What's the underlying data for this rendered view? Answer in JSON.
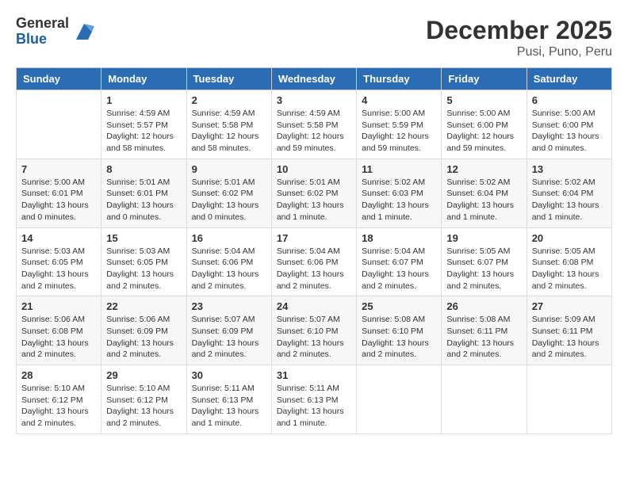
{
  "logo": {
    "general": "General",
    "blue": "Blue"
  },
  "title": "December 2025",
  "subtitle": "Pusi, Puno, Peru",
  "days_of_week": [
    "Sunday",
    "Monday",
    "Tuesday",
    "Wednesday",
    "Thursday",
    "Friday",
    "Saturday"
  ],
  "weeks": [
    [
      {
        "day": "",
        "info": ""
      },
      {
        "day": "1",
        "info": "Sunrise: 4:59 AM\nSunset: 5:57 PM\nDaylight: 12 hours\nand 58 minutes."
      },
      {
        "day": "2",
        "info": "Sunrise: 4:59 AM\nSunset: 5:58 PM\nDaylight: 12 hours\nand 58 minutes."
      },
      {
        "day": "3",
        "info": "Sunrise: 4:59 AM\nSunset: 5:58 PM\nDaylight: 12 hours\nand 59 minutes."
      },
      {
        "day": "4",
        "info": "Sunrise: 5:00 AM\nSunset: 5:59 PM\nDaylight: 12 hours\nand 59 minutes."
      },
      {
        "day": "5",
        "info": "Sunrise: 5:00 AM\nSunset: 6:00 PM\nDaylight: 12 hours\nand 59 minutes."
      },
      {
        "day": "6",
        "info": "Sunrise: 5:00 AM\nSunset: 6:00 PM\nDaylight: 13 hours\nand 0 minutes."
      }
    ],
    [
      {
        "day": "7",
        "info": "Sunrise: 5:00 AM\nSunset: 6:01 PM\nDaylight: 13 hours\nand 0 minutes."
      },
      {
        "day": "8",
        "info": "Sunrise: 5:01 AM\nSunset: 6:01 PM\nDaylight: 13 hours\nand 0 minutes."
      },
      {
        "day": "9",
        "info": "Sunrise: 5:01 AM\nSunset: 6:02 PM\nDaylight: 13 hours\nand 0 minutes."
      },
      {
        "day": "10",
        "info": "Sunrise: 5:01 AM\nSunset: 6:02 PM\nDaylight: 13 hours\nand 1 minute."
      },
      {
        "day": "11",
        "info": "Sunrise: 5:02 AM\nSunset: 6:03 PM\nDaylight: 13 hours\nand 1 minute."
      },
      {
        "day": "12",
        "info": "Sunrise: 5:02 AM\nSunset: 6:04 PM\nDaylight: 13 hours\nand 1 minute."
      },
      {
        "day": "13",
        "info": "Sunrise: 5:02 AM\nSunset: 6:04 PM\nDaylight: 13 hours\nand 1 minute."
      }
    ],
    [
      {
        "day": "14",
        "info": "Sunrise: 5:03 AM\nSunset: 6:05 PM\nDaylight: 13 hours\nand 2 minutes."
      },
      {
        "day": "15",
        "info": "Sunrise: 5:03 AM\nSunset: 6:05 PM\nDaylight: 13 hours\nand 2 minutes."
      },
      {
        "day": "16",
        "info": "Sunrise: 5:04 AM\nSunset: 6:06 PM\nDaylight: 13 hours\nand 2 minutes."
      },
      {
        "day": "17",
        "info": "Sunrise: 5:04 AM\nSunset: 6:06 PM\nDaylight: 13 hours\nand 2 minutes."
      },
      {
        "day": "18",
        "info": "Sunrise: 5:04 AM\nSunset: 6:07 PM\nDaylight: 13 hours\nand 2 minutes."
      },
      {
        "day": "19",
        "info": "Sunrise: 5:05 AM\nSunset: 6:07 PM\nDaylight: 13 hours\nand 2 minutes."
      },
      {
        "day": "20",
        "info": "Sunrise: 5:05 AM\nSunset: 6:08 PM\nDaylight: 13 hours\nand 2 minutes."
      }
    ],
    [
      {
        "day": "21",
        "info": "Sunrise: 5:06 AM\nSunset: 6:08 PM\nDaylight: 13 hours\nand 2 minutes."
      },
      {
        "day": "22",
        "info": "Sunrise: 5:06 AM\nSunset: 6:09 PM\nDaylight: 13 hours\nand 2 minutes."
      },
      {
        "day": "23",
        "info": "Sunrise: 5:07 AM\nSunset: 6:09 PM\nDaylight: 13 hours\nand 2 minutes."
      },
      {
        "day": "24",
        "info": "Sunrise: 5:07 AM\nSunset: 6:10 PM\nDaylight: 13 hours\nand 2 minutes."
      },
      {
        "day": "25",
        "info": "Sunrise: 5:08 AM\nSunset: 6:10 PM\nDaylight: 13 hours\nand 2 minutes."
      },
      {
        "day": "26",
        "info": "Sunrise: 5:08 AM\nSunset: 6:11 PM\nDaylight: 13 hours\nand 2 minutes."
      },
      {
        "day": "27",
        "info": "Sunrise: 5:09 AM\nSunset: 6:11 PM\nDaylight: 13 hours\nand 2 minutes."
      }
    ],
    [
      {
        "day": "28",
        "info": "Sunrise: 5:10 AM\nSunset: 6:12 PM\nDaylight: 13 hours\nand 2 minutes."
      },
      {
        "day": "29",
        "info": "Sunrise: 5:10 AM\nSunset: 6:12 PM\nDaylight: 13 hours\nand 2 minutes."
      },
      {
        "day": "30",
        "info": "Sunrise: 5:11 AM\nSunset: 6:13 PM\nDaylight: 13 hours\nand 1 minute."
      },
      {
        "day": "31",
        "info": "Sunrise: 5:11 AM\nSunset: 6:13 PM\nDaylight: 13 hours\nand 1 minute."
      },
      {
        "day": "",
        "info": ""
      },
      {
        "day": "",
        "info": ""
      },
      {
        "day": "",
        "info": ""
      }
    ]
  ]
}
